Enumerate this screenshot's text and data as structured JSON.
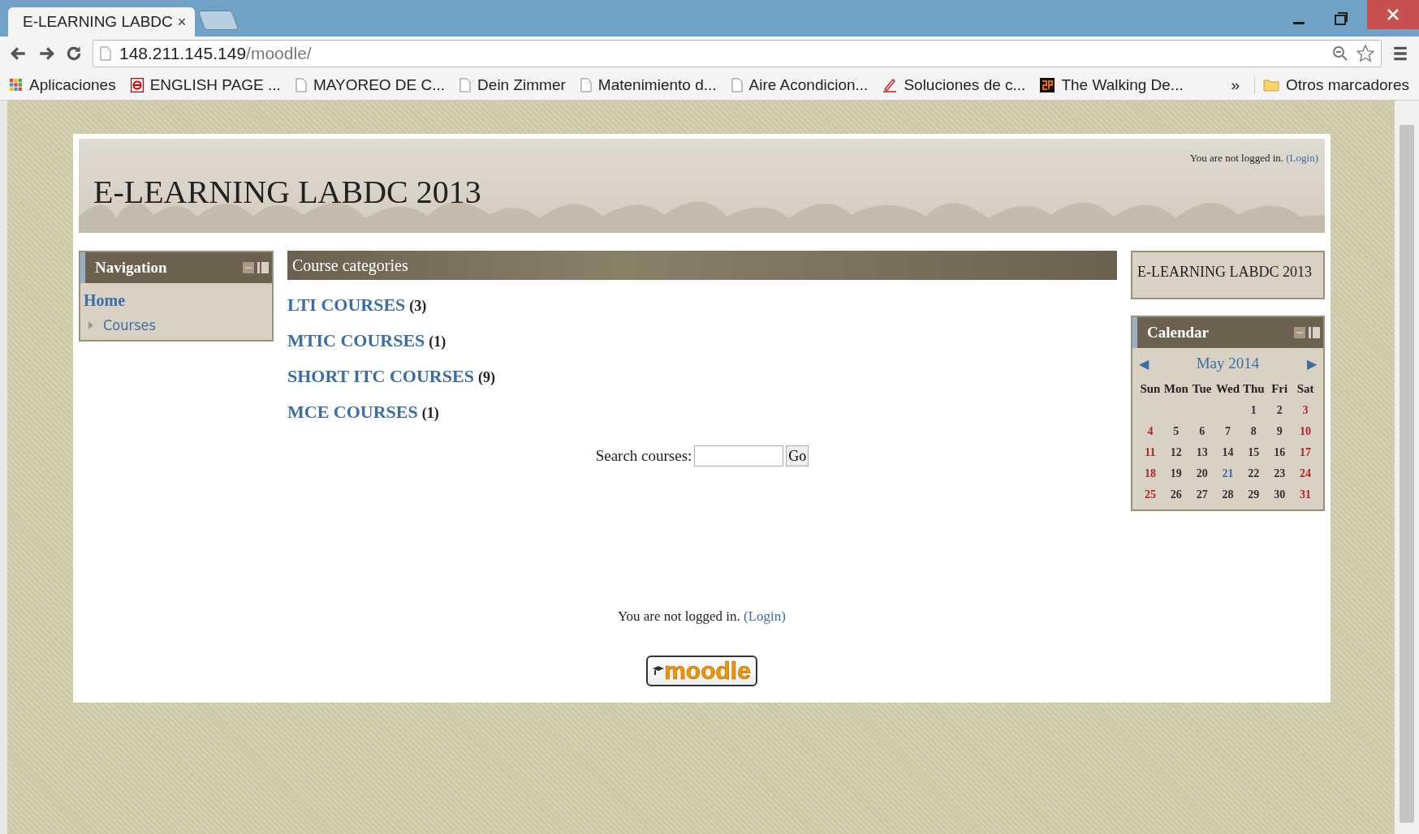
{
  "browser": {
    "tab": {
      "title": "E-LEARNING LABDC",
      "close": "×",
      "selected": true
    },
    "address": {
      "host": "148.211.145.149",
      "path": "/moodle/"
    },
    "bookmarks": [
      {
        "label": "Aplicaciones",
        "kind": "apps"
      },
      {
        "label": "ENGLISH PAGE ...",
        "kind": "e"
      },
      {
        "label": "MAYOREO DE C...",
        "kind": "page"
      },
      {
        "label": "Dein Zimmer",
        "kind": "page"
      },
      {
        "label": "Matenimiento d...",
        "kind": "page"
      },
      {
        "label": "Aire Acondicion...",
        "kind": "page"
      },
      {
        "label": "Soluciones de c...",
        "kind": "pen"
      },
      {
        "label": "The Walking De...",
        "kind": "sp"
      }
    ],
    "more": "»",
    "other_bookmarks": "Otros marcadores"
  },
  "header": {
    "title": "E-LEARNING LABDC 2013",
    "login_text": "You are not logged in.",
    "login_link": "(Login)"
  },
  "navigation": {
    "title": "Navigation",
    "items": [
      {
        "label": "Home",
        "kind": "home"
      },
      {
        "label": "Courses",
        "kind": "branch"
      }
    ]
  },
  "categories": {
    "title": "Course categories",
    "items": [
      {
        "name": "LTI COURSES",
        "count": "(3)"
      },
      {
        "name": "MTIC COURSES",
        "count": "(1)"
      },
      {
        "name": "SHORT ITC COURSES",
        "count": "(9)"
      },
      {
        "name": "MCE COURSES",
        "count": "(1)"
      }
    ],
    "search": {
      "label": "Search courses:",
      "button": "Go"
    }
  },
  "site_block": {
    "title": "E-LEARNING LABDC 2013"
  },
  "calendar": {
    "title": "Calendar",
    "month": "May 2014",
    "prev": "◀",
    "next": "▶",
    "weekdays": [
      "Sun",
      "Mon",
      "Tue",
      "Wed",
      "Thu",
      "Fri",
      "Sat"
    ],
    "weeks": [
      [
        {
          "d": "1",
          "kind": "weekday"
        },
        {
          "d": "2",
          "kind": "weekday"
        },
        {
          "d": "3",
          "kind": "weekend"
        }
      ],
      [
        {
          "d": "4",
          "kind": "weekend"
        },
        {
          "d": "5",
          "kind": "weekday"
        },
        {
          "d": "6",
          "kind": "weekday"
        },
        {
          "d": "7",
          "kind": "weekday"
        },
        {
          "d": "8",
          "kind": "weekday"
        },
        {
          "d": "9",
          "kind": "weekday"
        },
        {
          "d": "10",
          "kind": "weekend"
        }
      ],
      [
        {
          "d": "11",
          "kind": "weekend"
        },
        {
          "d": "12",
          "kind": "weekday"
        },
        {
          "d": "13",
          "kind": "weekday"
        },
        {
          "d": "14",
          "kind": "weekday"
        },
        {
          "d": "15",
          "kind": "weekday"
        },
        {
          "d": "16",
          "kind": "weekday"
        },
        {
          "d": "17",
          "kind": "weekend"
        }
      ],
      [
        {
          "d": "18",
          "kind": "weekend"
        },
        {
          "d": "19",
          "kind": "weekday"
        },
        {
          "d": "20",
          "kind": "weekday"
        },
        {
          "d": "21",
          "kind": "today"
        },
        {
          "d": "22",
          "kind": "weekday"
        },
        {
          "d": "23",
          "kind": "weekday"
        },
        {
          "d": "24",
          "kind": "weekend"
        }
      ],
      [
        {
          "d": "25",
          "kind": "weekend"
        },
        {
          "d": "26",
          "kind": "weekday"
        },
        {
          "d": "27",
          "kind": "weekday"
        },
        {
          "d": "28",
          "kind": "weekday"
        },
        {
          "d": "29",
          "kind": "weekday"
        },
        {
          "d": "30",
          "kind": "weekday"
        },
        {
          "d": "31",
          "kind": "weekend"
        }
      ]
    ]
  },
  "footer": {
    "login_text": "You are not logged in.",
    "login_link": "(Login)",
    "logo": "moodle"
  }
}
